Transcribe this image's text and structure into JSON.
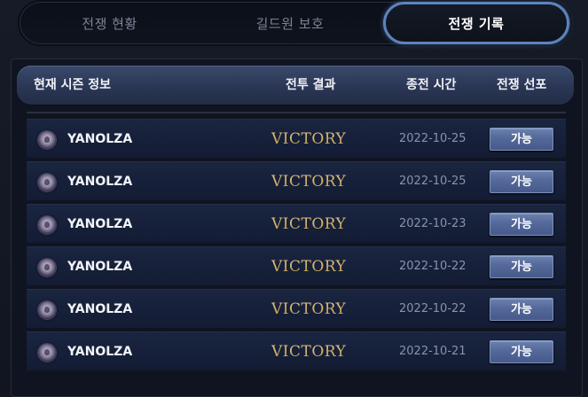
{
  "tabs": [
    {
      "label": "전쟁 현황",
      "active": false
    },
    {
      "label": "길드원 보호",
      "active": false
    },
    {
      "label": "전쟁 기록",
      "active": true
    }
  ],
  "table": {
    "headers": {
      "info": "현재 시즌 정보",
      "result": "전투 결과",
      "time": "종전 시간",
      "declaration": "전쟁 선포"
    },
    "rows": [
      {
        "guild": "YANOLZA",
        "result": "VICTORY",
        "date": "2022-10-25",
        "action": "가능"
      },
      {
        "guild": "YANOLZA",
        "result": "VICTORY",
        "date": "2022-10-25",
        "action": "가능"
      },
      {
        "guild": "YANOLZA",
        "result": "VICTORY",
        "date": "2022-10-23",
        "action": "가능"
      },
      {
        "guild": "YANOLZA",
        "result": "VICTORY",
        "date": "2022-10-22",
        "action": "가능"
      },
      {
        "guild": "YANOLZA",
        "result": "VICTORY",
        "date": "2022-10-22",
        "action": "가능"
      },
      {
        "guild": "YANOLZA",
        "result": "VICTORY",
        "date": "2022-10-21",
        "action": "가능"
      }
    ]
  },
  "colors": {
    "active_tab_border": "#5d83be",
    "victory_gold": "#d6b676",
    "button_blue": "#54699a"
  },
  "icons": {
    "guild_emblem": "guild-emblem-icon"
  }
}
